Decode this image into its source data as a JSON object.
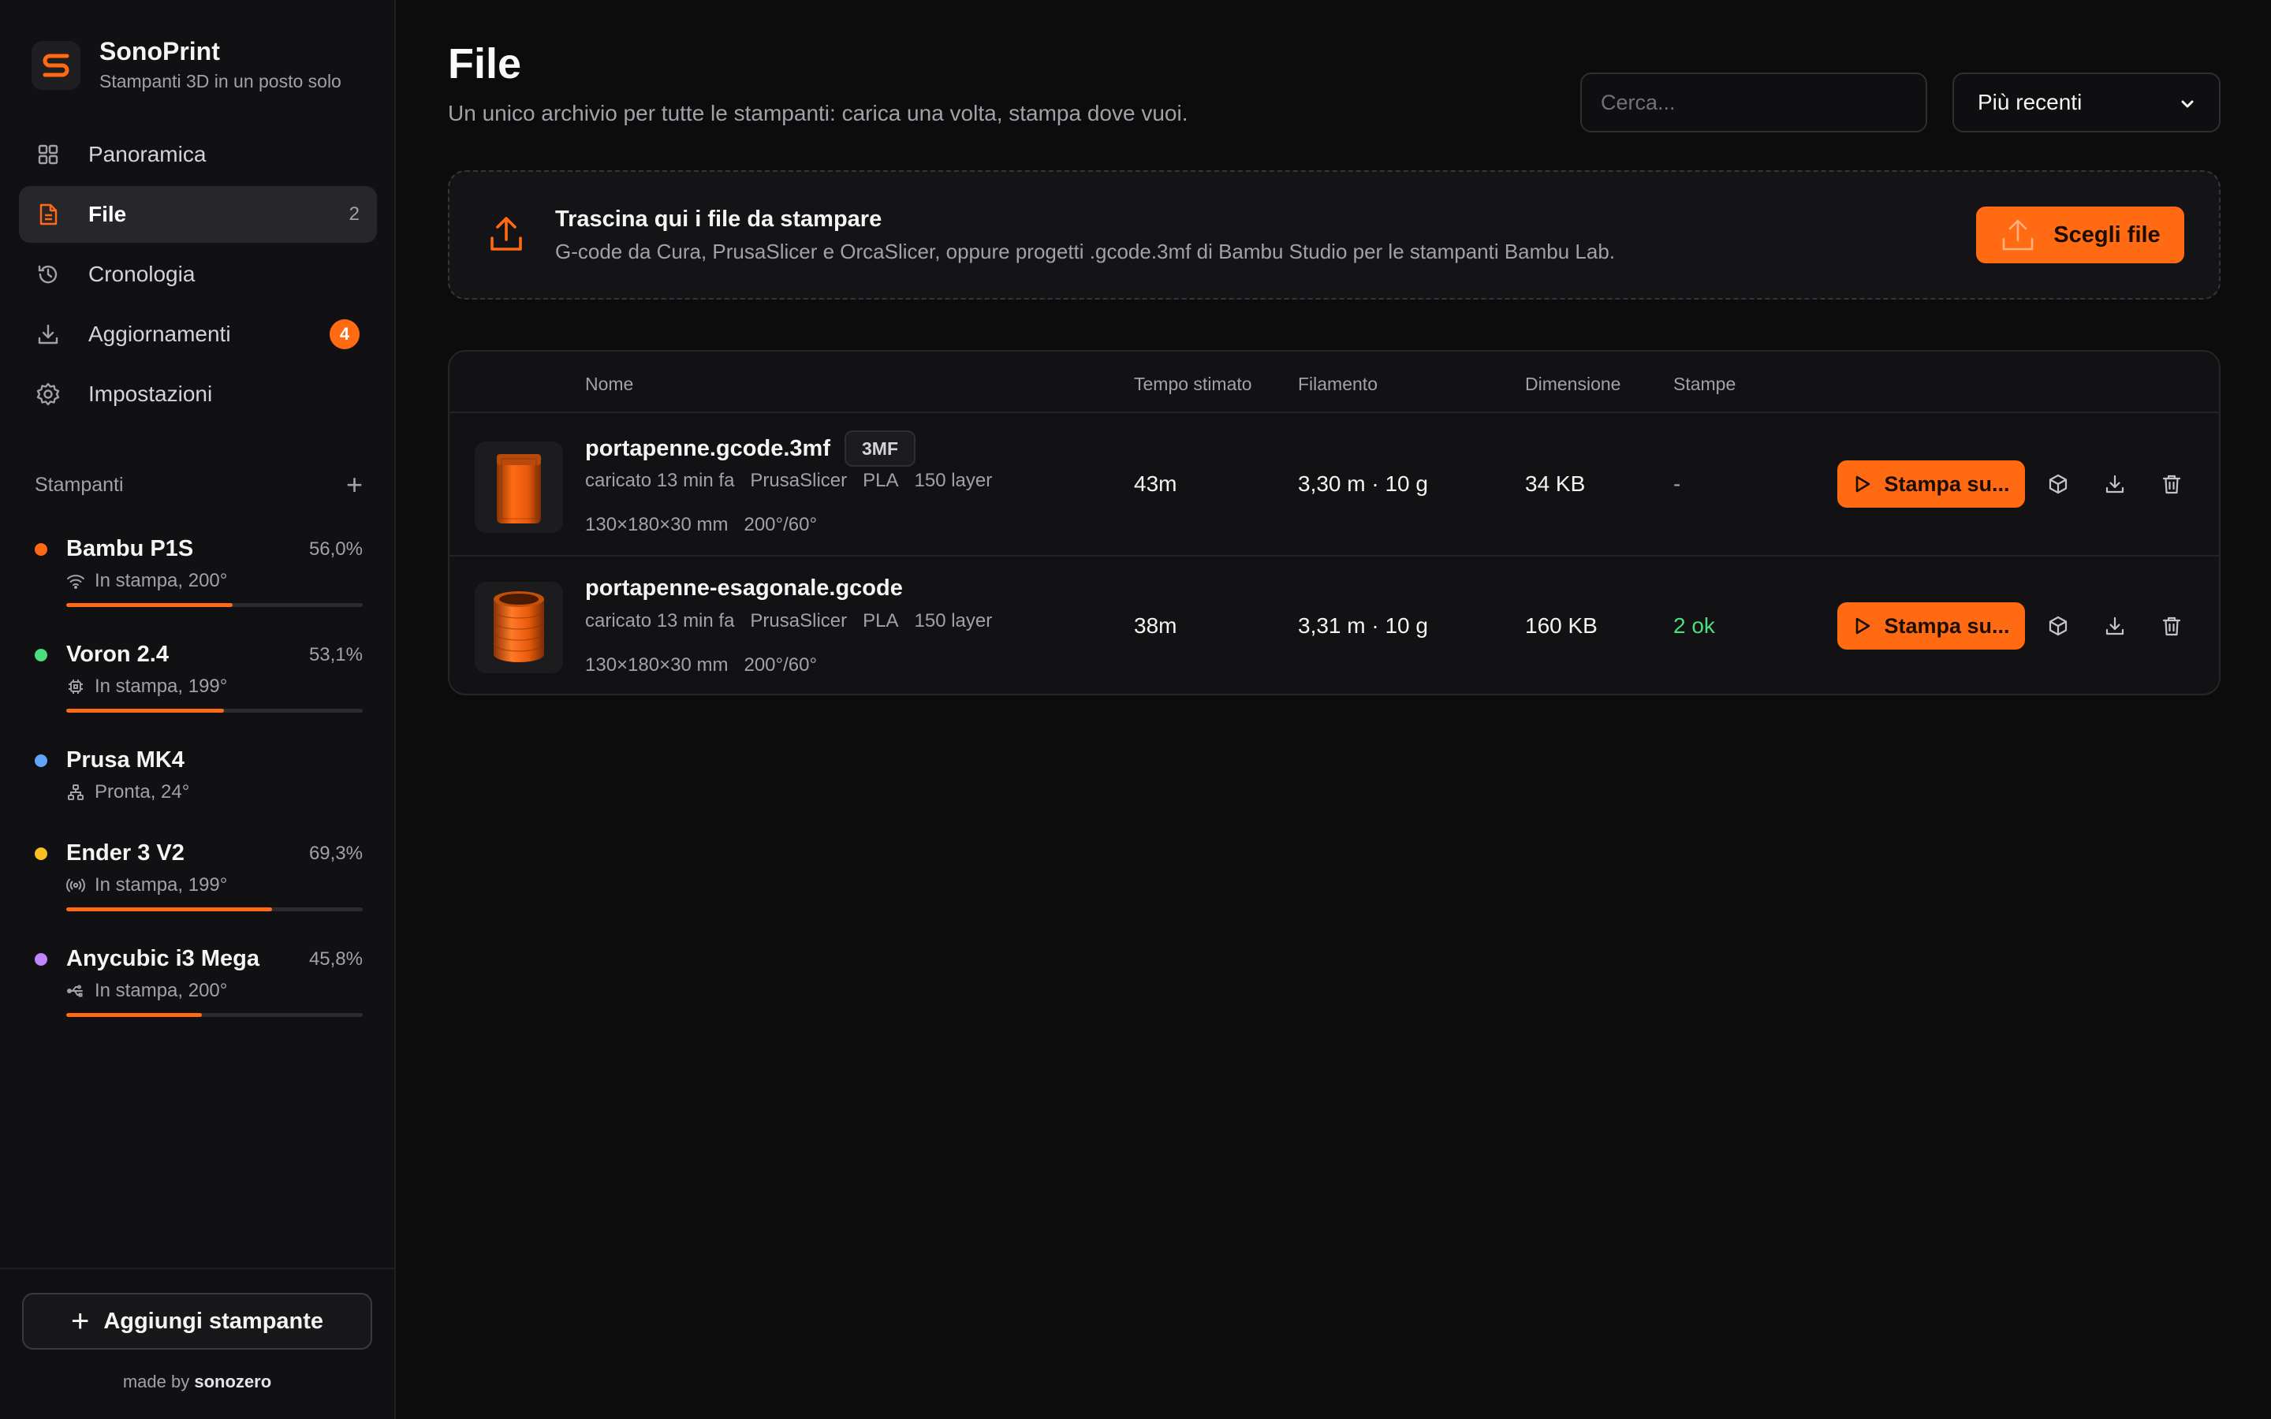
{
  "app": {
    "name": "SonoPrint",
    "tagline": "Stampanti 3D in un posto solo",
    "logo_letter": "S"
  },
  "nav": [
    {
      "label": "Panoramica",
      "icon": "grid-icon"
    },
    {
      "label": "File",
      "icon": "file-icon",
      "count": "2",
      "active": true
    },
    {
      "label": "Cronologia",
      "icon": "history-icon"
    },
    {
      "label": "Aggiornamenti",
      "icon": "download-icon",
      "badge": "4"
    },
    {
      "label": "Impostazioni",
      "icon": "gear-icon"
    }
  ],
  "printers_section": {
    "title": "Stampanti",
    "add_symbol": "+"
  },
  "printers": [
    {
      "name": "Bambu P1S",
      "pct": "56,0%",
      "progress": 0.56,
      "status": "In stampa, 200°",
      "dot_color": "#ff6a13",
      "status_icon": "wifi-icon"
    },
    {
      "name": "Voron 2.4",
      "pct": "53,1%",
      "progress": 0.531,
      "status": "In stampa, 199°",
      "dot_color": "#4ade80",
      "status_icon": "chip-icon"
    },
    {
      "name": "Prusa MK4",
      "pct": "",
      "status": "Pronta, 24°",
      "dot_color": "#60a5fa",
      "status_icon": "network-icon"
    },
    {
      "name": "Ender 3 V2",
      "pct": "69,3%",
      "progress": 0.693,
      "status": "In stampa, 199°",
      "dot_color": "#fbbf24",
      "status_icon": "radio-icon"
    },
    {
      "name": "Anycubic i3 Mega",
      "pct": "45,8%",
      "progress": 0.458,
      "status": "In stampa, 200°",
      "dot_color": "#c084fc",
      "status_icon": "usb-icon"
    }
  ],
  "sidebar_footer": {
    "add_printer_label": "Aggiungi stampante",
    "made_by_prefix": "made by",
    "made_by_name": "sonozero"
  },
  "page": {
    "title": "File",
    "subtitle": "Un unico archivio per tutte le stampanti: carica una volta, stampa dove vuoi."
  },
  "search": {
    "placeholder": "Cerca..."
  },
  "sort": {
    "selected": "Più recenti"
  },
  "dropzone": {
    "title": "Trascina qui i file da stampare",
    "description": "G-code da Cura, PrusaSlicer e OrcaSlicer, oppure progetti .gcode.3mf di Bambu Studio per le stampanti Bambu Lab.",
    "button_label": "Scegli file"
  },
  "table": {
    "headers": [
      "Nome",
      "Tempo stimato",
      "Filamento",
      "Dimensione",
      "Stampe"
    ],
    "rows": [
      {
        "name": "portapenne.gcode.3mf",
        "type_badge": "3MF",
        "uploaded": "caricato 13 min fa",
        "slicer": "PrusaSlicer",
        "material": "PLA",
        "layers": "150 layer",
        "dimensions": "130×180×30 mm",
        "temps": "200°/60°",
        "time": "43m",
        "filament": "3,30 m · 10 g",
        "size": "34 KB",
        "prints": "-",
        "print_button": "Stampa su..."
      },
      {
        "name": "portapenne-esagonale.gcode",
        "type_badge": "",
        "uploaded": "caricato 13 min fa",
        "slicer": "PrusaSlicer",
        "material": "PLA",
        "layers": "150 layer",
        "dimensions": "130×180×30 mm",
        "temps": "200°/60°",
        "time": "38m",
        "filament": "3,31 m · 10 g",
        "size": "160 KB",
        "prints": "2 ok",
        "print_button": "Stampa su..."
      }
    ]
  },
  "colors": {
    "accent": "#ff6a13",
    "success": "#4ade80",
    "background": "#0c0c0d",
    "sidebar": "#111113"
  }
}
